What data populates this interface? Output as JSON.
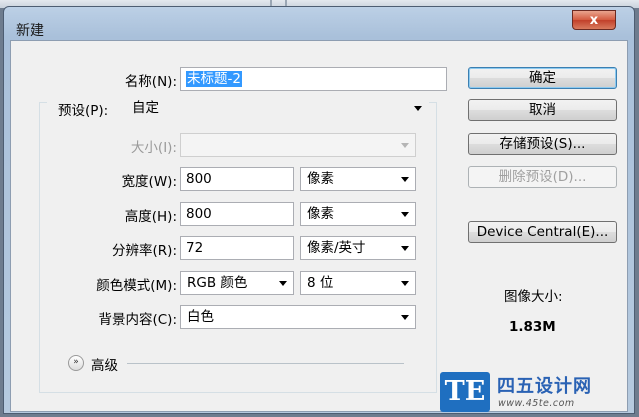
{
  "window": {
    "title": "新建",
    "close_label": "x"
  },
  "form": {
    "name_label": "名称(N):",
    "name_value": "未标题-2",
    "preset_label": "预设(P):",
    "preset_value": "自定",
    "size_label": "大小(I):",
    "size_value": "",
    "width_label": "宽度(W):",
    "width_value": "800",
    "width_unit": "像素",
    "height_label": "高度(H):",
    "height_value": "800",
    "height_unit": "像素",
    "resolution_label": "分辨率(R):",
    "resolution_value": "72",
    "resolution_unit": "像素/英寸",
    "color_mode_label": "颜色模式(M):",
    "color_mode_value": "RGB 颜色",
    "bit_depth_value": "8 位",
    "background_label": "背景内容(C):",
    "background_value": "白色",
    "advanced_label": "高级"
  },
  "buttons": {
    "ok": "确定",
    "cancel": "取消",
    "save_preset": "存储预设(S)...",
    "delete_preset": "删除预设(D)...",
    "device_central": "Device Central(E)..."
  },
  "info": {
    "image_size_label": "图像大小:",
    "image_size_value": "1.83M"
  },
  "watermark": {
    "badge": "TE",
    "title": "四五设计网",
    "url": "www.45te.com"
  }
}
